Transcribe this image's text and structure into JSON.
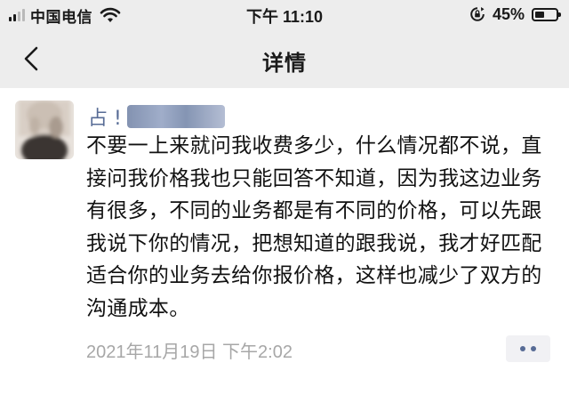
{
  "status_bar": {
    "carrier": "中国电信",
    "time": "下午 11:10",
    "battery_percent": "45%",
    "battery_level": 0.45,
    "icons": [
      "signal-icon",
      "wifi-icon",
      "rotation-lock-icon",
      "battery-icon"
    ]
  },
  "navbar": {
    "title": "详情",
    "back_icon": "chevron-left-icon"
  },
  "comment": {
    "author": "占 !",
    "text": "不要一上来就问我收费多少，什么情况都不说，直接问我价格我也只能回答不知道，因为我这边业务有很多，不同的业务都是有不同的价格，可以先跟我说下你的情况，把想知道的跟我说，我才好匹配适合你的业务去给你报价格，这样也减少了双方的沟通成本。",
    "timestamp": "2021年11月19日 下午2:02"
  },
  "colors": {
    "header_bg": "#ededed",
    "link_name": "#576b95",
    "timestamp": "#a7a7a7"
  }
}
